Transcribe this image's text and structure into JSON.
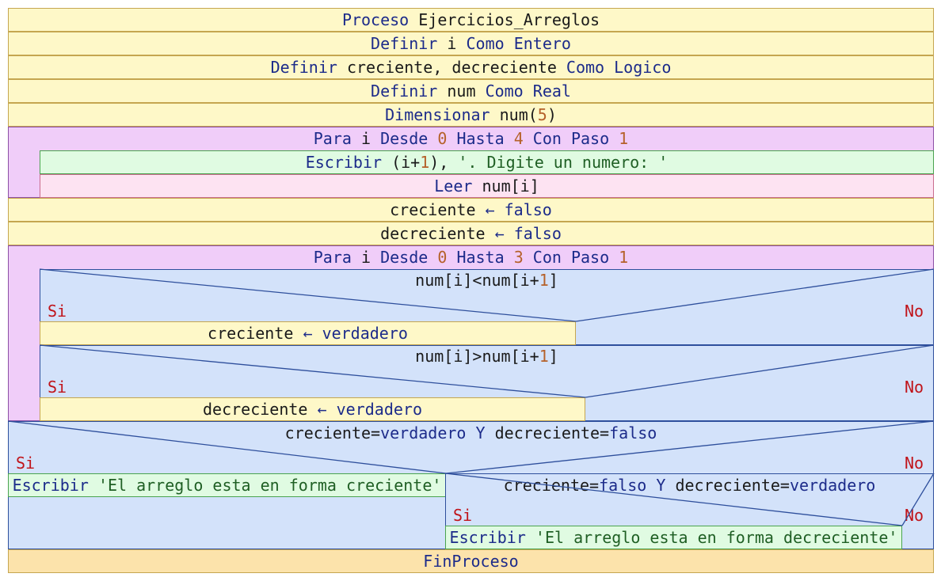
{
  "process": {
    "header": {
      "kw": "Proceso",
      "name": "Ejercicios_Arreglos"
    },
    "footer": "FinProceso"
  },
  "definitions": [
    {
      "k1": "Definir",
      "vars": "i",
      "k2": "Como",
      "type": "Entero"
    },
    {
      "k1": "Definir",
      "vars": "creciente, decreciente",
      "k2": "Como",
      "type": "Logico"
    },
    {
      "k1": "Definir",
      "vars": "num",
      "k2": "Como",
      "type": "Real"
    }
  ],
  "dimension": {
    "kw": "Dimensionar",
    "name": "num(",
    "size": "5",
    "close": ")"
  },
  "loop1": {
    "kw_para": "Para",
    "var": "i",
    "kw_desde": "Desde",
    "from": "0",
    "kw_hasta": "Hasta",
    "to": "4",
    "kw_con": "Con Paso",
    "step": "1",
    "write": {
      "kw": "Escribir",
      "a": "(i+",
      "n": "1",
      "b": "),",
      "str": "'. Digite un numero: '"
    },
    "read": {
      "kw": "Leer",
      "var": "num[i]"
    }
  },
  "assign1": {
    "var": "creciente",
    "arrow": "←",
    "val": "falso"
  },
  "assign2": {
    "var": "decreciente",
    "arrow": "←",
    "val": "falso"
  },
  "loop2": {
    "kw_para": "Para",
    "var": "i",
    "kw_desde": "Desde",
    "from": "0",
    "kw_hasta": "Hasta",
    "to": "3",
    "kw_con": "Con Paso",
    "step": "1",
    "cond1": {
      "a": "num[i]<num[i+",
      "n": "1",
      "b": "]",
      "yes": "Si",
      "no": "No",
      "action": {
        "var": "creciente",
        "arrow": "←",
        "val": "verdadero"
      }
    },
    "cond2": {
      "a": "num[i]>num[i+",
      "n": "1",
      "b": "]",
      "yes": "Si",
      "no": "No",
      "action": {
        "var": "decreciente",
        "arrow": "←",
        "val": "verdadero"
      }
    }
  },
  "final_cond": {
    "a": "creciente=",
    "b": "verdadero",
    "y": "Y",
    "c": "decreciente=",
    "d": "falso",
    "yes": "Si",
    "no": "No",
    "yes_action": {
      "kw": "Escribir",
      "str": "'El arreglo esta en forma creciente'"
    },
    "inner": {
      "a": "creciente=",
      "b": "falso",
      "y": "Y",
      "c": "decreciente=",
      "d": "verdadero",
      "yes": "Si",
      "no": "No",
      "yes_action": {
        "kw": "Escribir",
        "str": "'El arreglo esta en forma decreciente'"
      }
    }
  },
  "colors": {
    "process": "#fef8c8",
    "process_end": "#fce3ab",
    "loop": "#f0cdf9",
    "output": "#e0fbe2",
    "input": "#fde3f2",
    "condition": "#d3e2fa",
    "keyword": "#1c2b8a",
    "number": "#b5612a",
    "string": "#1f5f24",
    "yes_no": "#c0141a"
  }
}
